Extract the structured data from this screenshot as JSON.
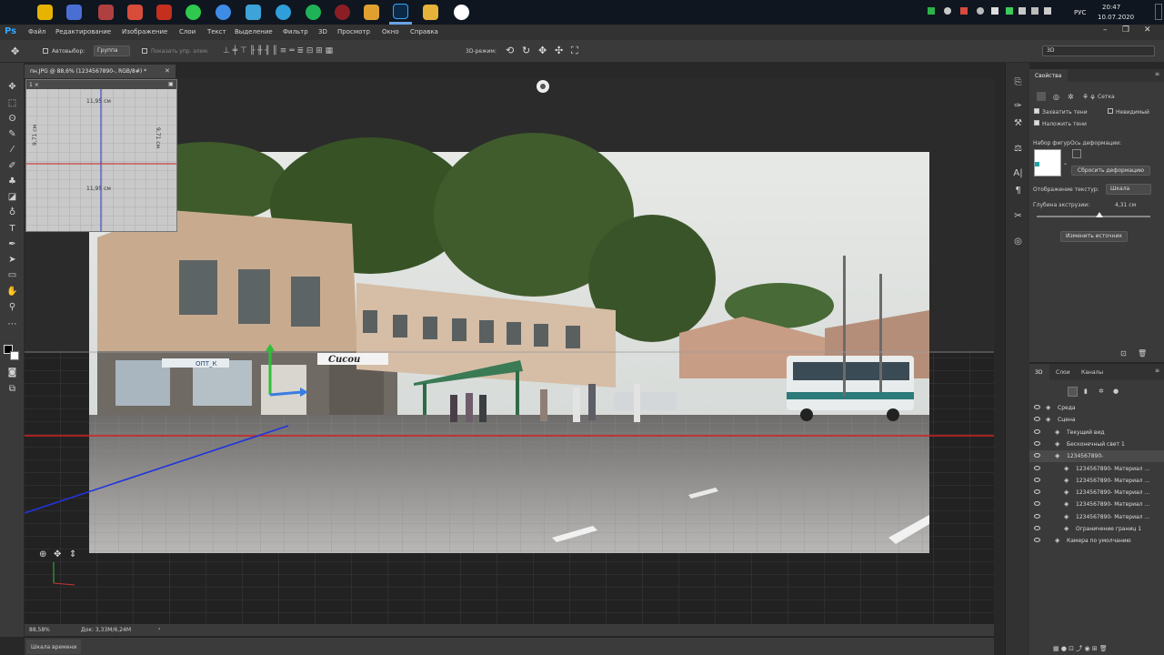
{
  "taskbar": {
    "lang": "РУС",
    "time": "20:47",
    "date": "10.07.2020"
  },
  "app": {
    "logo": "Ps",
    "menu": [
      "Файл",
      "Редактирование",
      "Изображение",
      "Слои",
      "Текст",
      "Выделение",
      "Фильтр",
      "3D",
      "Просмотр",
      "Окно",
      "Справка"
    ],
    "workspace": "3D"
  },
  "options": {
    "autoselect_label": "Автовыбор:",
    "autoselect_value": "Группа",
    "show_controls": "Показать упр. элем.",
    "mode3d_label": "3D-режим:"
  },
  "document": {
    "tab_title": "пн.JPG @ 88,6% (1234567890-, RGB/8#) *",
    "zoom": "88,58%",
    "doc_size": "Док: 3,33M/6,24M"
  },
  "uv_overlay": {
    "label_top": "11,95 см",
    "label_bottom": "11,95 см",
    "label_left": "9,71 см",
    "label_right": "9,71 см",
    "header": "1 ×"
  },
  "timeline": {
    "label": "Шкала времени"
  },
  "properties": {
    "title": "Свойства",
    "tab_mesh": "Сетка",
    "catch_shadows": "Захватить тени",
    "invisible": "Невидимый",
    "cast_shadows": "Наложить тени",
    "shape_preset": "Набор фигур",
    "deform_axis": "Ось деформации:",
    "reset_deform": "Сбросить деформацию",
    "texture_mapping_label": "Отображение текстур:",
    "texture_mapping_value": "Шкала",
    "extrusion_label": "Глубина экструзии:",
    "extrusion_value": "4,31 см",
    "extrusion_fraction": 0.55,
    "edit_source": "Изменить источник"
  },
  "layers_panel": {
    "tabs": [
      "3D",
      "Слои",
      "Каналы"
    ],
    "items": [
      {
        "label": "Среда",
        "indent": 0
      },
      {
        "label": "Сцена",
        "indent": 0
      },
      {
        "label": "Текущий вид",
        "indent": 1
      },
      {
        "label": "Бесконечный свет 1",
        "indent": 1
      },
      {
        "label": "1234567890-",
        "indent": 1
      },
      {
        "label": "1234567890- Материал ...",
        "indent": 2
      },
      {
        "label": "1234567890- Материал ...",
        "indent": 2
      },
      {
        "label": "1234567890- Материал ...",
        "indent": 2
      },
      {
        "label": "1234567890- Материал ...",
        "indent": 2
      },
      {
        "label": "1234567890- Материал ...",
        "indent": 2
      },
      {
        "label": "Ограничение границ 1",
        "indent": 2
      },
      {
        "label": "Камера по умолчанию",
        "indent": 1
      }
    ]
  },
  "scene": {
    "sign_left": "ОПТ_К",
    "sign_shop": "Сисои"
  }
}
